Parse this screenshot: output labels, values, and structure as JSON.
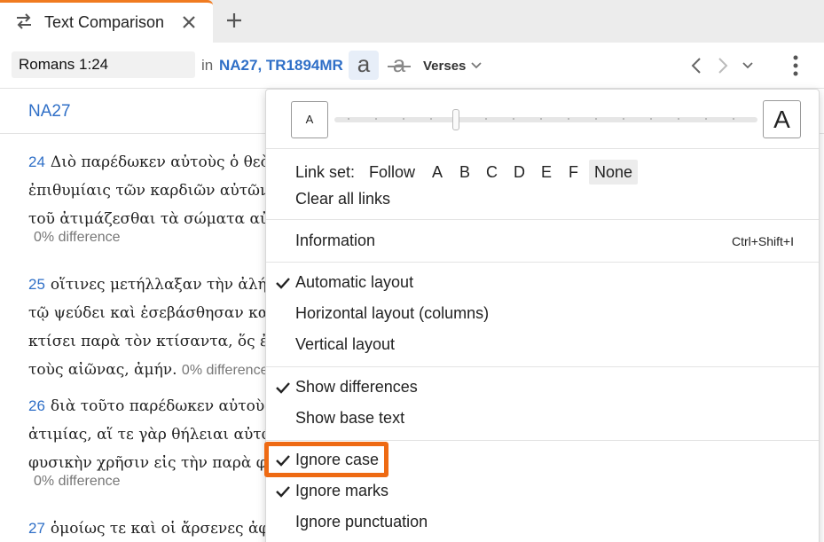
{
  "tab": {
    "title": "Text Comparison"
  },
  "toolbar": {
    "reference": "Romans 1:24",
    "in_label": "in",
    "versions": "NA27, TR1894MR",
    "case_glyph": "a",
    "strike_glyph": "a",
    "verses_label": "Verses"
  },
  "pane": {
    "name": "NA27",
    "verses": [
      {
        "num": "24",
        "lines": [
          "Διὸ παρέδωκεν αὐτοὺς ὁ θεὸς",
          "ἐπιθυμίαις τῶν καρδιῶν αὐτῶν εἰς",
          "τοῦ ἀτιμάζεσθαι τὰ σώματα αὐτῶν"
        ],
        "diff": "0% difference"
      },
      {
        "num": "25",
        "lines": [
          "οἵτινες μετήλλαξαν τὴν ἀλήθειαν",
          "τῷ ψεύδει καὶ ἐσεβάσθησαν καὶ",
          "κτίσει παρὰ τὸν κτίσαντα, ὅς ἐστιν",
          "τοὺς αἰῶνας, ἀμήν."
        ],
        "diff": "0% difference"
      },
      {
        "num": "26",
        "lines": [
          "διὰ τοῦτο παρέδωκεν αὐτοὺς",
          "ἀτιμίας, αἵ τε γὰρ θήλειαι αὐτῶν",
          "φυσικὴν χρῆσιν εἰς τὴν παρὰ φύσιν"
        ],
        "diff": "0% difference"
      },
      {
        "num": "27",
        "lines": [
          "ὁμοίως τε καὶ οἱ ἄρσενες ἀφέντες"
        ]
      }
    ]
  },
  "menu": {
    "font_small": "A",
    "font_large": "A",
    "link_set_label": "Link set:",
    "link_options": [
      "Follow",
      "A",
      "B",
      "C",
      "D",
      "E",
      "F",
      "None"
    ],
    "link_selected": "None",
    "clear_links": "Clear all links",
    "information": "Information",
    "information_shortcut": "Ctrl+Shift+I",
    "layout_auto": "Automatic layout",
    "layout_horizontal": "Horizontal layout (columns)",
    "layout_vertical": "Vertical layout",
    "show_differences": "Show differences",
    "show_base_text": "Show base text",
    "ignore_case": "Ignore case",
    "ignore_marks": "Ignore marks",
    "ignore_punctuation": "Ignore punctuation"
  },
  "colors": {
    "accent": "#2f6fc7",
    "tab_accent": "#f07b20",
    "highlight": "#ee6a13"
  }
}
